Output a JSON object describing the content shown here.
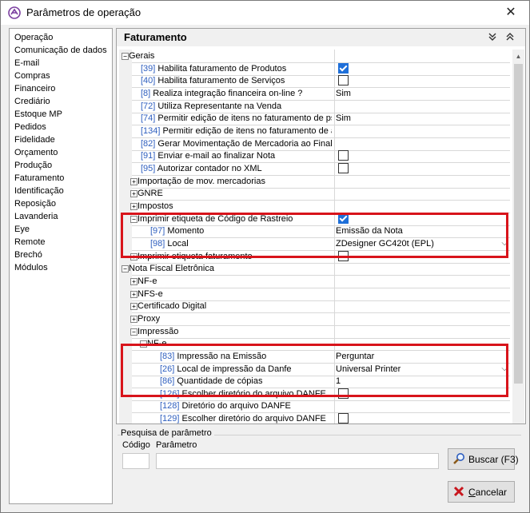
{
  "window": {
    "title": "Parâmetros de operação",
    "close_glyph": "✕"
  },
  "sidebar": {
    "items": [
      {
        "label": "Operação"
      },
      {
        "label": "Comunicação de dados"
      },
      {
        "label": "E-mail"
      },
      {
        "label": "Compras"
      },
      {
        "label": "Financeiro"
      },
      {
        "label": "Crediário"
      },
      {
        "label": "Estoque MP"
      },
      {
        "label": "Pedidos"
      },
      {
        "label": "Fidelidade"
      },
      {
        "label": "Orçamento"
      },
      {
        "label": "Produção"
      },
      {
        "label": "Faturamento"
      },
      {
        "label": "Identificação"
      },
      {
        "label": "Reposição"
      },
      {
        "label": "Lavanderia"
      },
      {
        "label": "Eye"
      },
      {
        "label": "Remote"
      },
      {
        "label": "Brechó"
      },
      {
        "label": "Módulos"
      }
    ]
  },
  "section": {
    "title": "Faturamento",
    "collapse_glyph": "⌄⌄",
    "expand_glyph": "⌃⌃"
  },
  "grid": {
    "rows": [
      {
        "level": 0,
        "type": "group",
        "expander": "−",
        "name": "Gerais",
        "value": ""
      },
      {
        "level": 1,
        "type": "param",
        "code": "[39]",
        "name": " Habilita faturamento de Produtos",
        "value_type": "checkbox",
        "checked": true
      },
      {
        "level": 1,
        "type": "param",
        "code": "[40]",
        "name": " Habilita faturamento de Serviços",
        "value_type": "checkbox",
        "checked": false
      },
      {
        "level": 1,
        "type": "param",
        "code": "[8]",
        "name": " Realiza integração financeira on-line ?",
        "value_type": "text",
        "value": "Sim"
      },
      {
        "level": 1,
        "type": "param",
        "code": "[72]",
        "name": " Utiliza Representante na Venda",
        "value_type": "empty"
      },
      {
        "level": 1,
        "type": "param",
        "code": "[74]",
        "name": " Permitir edição de itens no faturamento de ps",
        "value_type": "text",
        "value": "Sim"
      },
      {
        "level": 1,
        "type": "param",
        "code": "[134]",
        "name": " Permitir edição de itens no faturamento de a",
        "value_type": "empty"
      },
      {
        "level": 1,
        "type": "param",
        "code": "[82]",
        "name": " Gerar Movimentação de Mercadoria ao Finalia",
        "value_type": "empty"
      },
      {
        "level": 1,
        "type": "param",
        "code": "[91]",
        "name": " Enviar e-mail ao finalizar Nota",
        "value_type": "checkbox",
        "checked": false
      },
      {
        "level": 1,
        "type": "param",
        "code": "[95]",
        "name": " Autorizar contador no XML",
        "value_type": "checkbox",
        "checked": false
      },
      {
        "level": 1,
        "type": "group",
        "expander": "+",
        "name": "Importação de mov. mercadorias",
        "value_type": "empty"
      },
      {
        "level": 1,
        "type": "group",
        "expander": "+",
        "name": "GNRE",
        "value_type": "empty"
      },
      {
        "level": 1,
        "type": "group",
        "expander": "+",
        "name": "Impostos",
        "value_type": "empty"
      },
      {
        "level": 1,
        "type": "group",
        "expander": "−",
        "name": "Imprimir etiqueta de Código de Rastreio",
        "value_type": "checkbox",
        "checked": true
      },
      {
        "level": 2,
        "type": "param",
        "code": "[97]",
        "name": " Momento",
        "value_type": "text",
        "value": "Emissão da Nota"
      },
      {
        "level": 2,
        "type": "param",
        "code": "[98]",
        "name": " Local",
        "value_type": "dropdown",
        "value": "ZDesigner GC420t (EPL)"
      },
      {
        "level": 1,
        "type": "group",
        "expander": "+",
        "name": "Imprimir etiqueta faturamento",
        "value_type": "checkbox",
        "checked": false
      },
      {
        "level": 0,
        "type": "group",
        "expander": "−",
        "name": "Nota Fiscal Eletrônica",
        "value_type": "empty"
      },
      {
        "level": 1,
        "type": "group",
        "expander": "+",
        "name": "NF-e",
        "value_type": "empty"
      },
      {
        "level": 1,
        "type": "group",
        "expander": "+",
        "name": "NFS-e",
        "value_type": "empty"
      },
      {
        "level": 1,
        "type": "group",
        "expander": "+",
        "name": "Certificado Digital",
        "value_type": "empty"
      },
      {
        "level": 1,
        "type": "group",
        "expander": "+",
        "name": "Proxy",
        "value_type": "empty"
      },
      {
        "level": 1,
        "type": "group",
        "expander": "−",
        "name": "Impressão",
        "value_type": "empty"
      },
      {
        "level": 2,
        "type": "group",
        "expander": "−",
        "name": "NF-e",
        "value_type": "empty"
      },
      {
        "level": 3,
        "type": "param",
        "code": "[83]",
        "name": " Impressão na Emissão",
        "value_type": "text",
        "value": "Perguntar"
      },
      {
        "level": 3,
        "type": "param",
        "code": "[26]",
        "name": " Local de impressão da Danfe",
        "value_type": "dropdown",
        "value": "Universal Printer"
      },
      {
        "level": 3,
        "type": "param",
        "code": "[86]",
        "name": " Quantidade de cópias",
        "value_type": "text",
        "value": "1"
      },
      {
        "level": 3,
        "type": "param",
        "code": "[126]",
        "name": " Escolher diretório do arquivo DANFE",
        "value_type": "checkbox",
        "checked": false
      },
      {
        "level": 3,
        "type": "param",
        "code": "[128]",
        "name": " Diretório do arquivo DANFE",
        "value_type": "empty"
      },
      {
        "level": 3,
        "type": "param",
        "code": "[129]",
        "name": " Escolher diretório do arquivo DANFE",
        "value_type": "checkbox",
        "checked": false
      }
    ]
  },
  "search": {
    "legend": "Pesquisa de parâmetro",
    "code_label": "Código",
    "param_label": "Parâmetro",
    "code_value": "",
    "param_value": ""
  },
  "buttons": {
    "search_label_prefix": "Buscar (F3)",
    "cancel_label_underlined": "C",
    "cancel_label_rest": "ancelar"
  },
  "colors": {
    "accent": "#1e6fd9",
    "highlight": "#d8141b",
    "code_link": "#2f5fbf"
  }
}
